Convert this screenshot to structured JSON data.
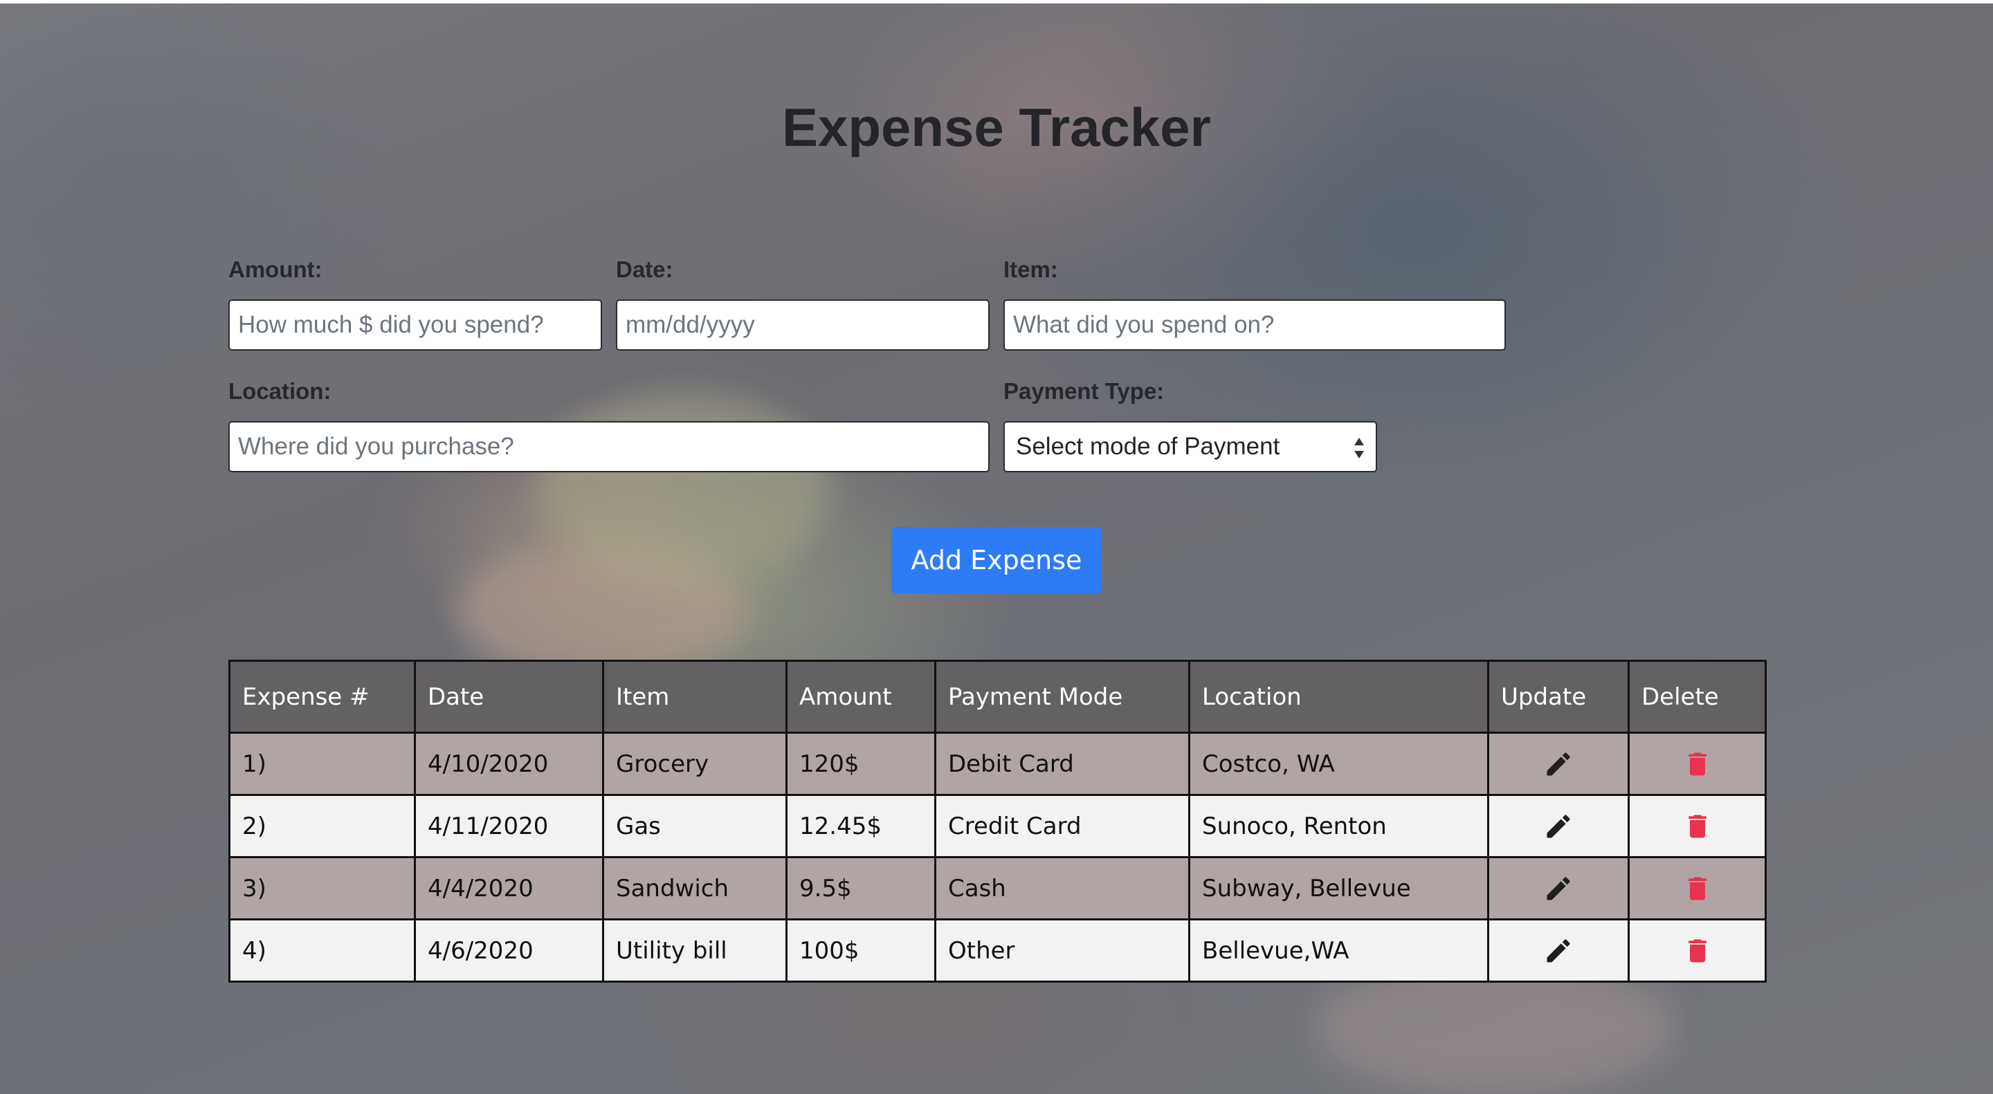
{
  "app": {
    "title": "Expense Tracker"
  },
  "form": {
    "amount": {
      "label": "Amount:",
      "placeholder": "How much $ did you spend?"
    },
    "date": {
      "label": "Date:",
      "placeholder": "mm/dd/yyyy"
    },
    "item": {
      "label": "Item:",
      "placeholder": "What did you spend on?"
    },
    "location": {
      "label": "Location:",
      "placeholder": "Where did you purchase?"
    },
    "payment_type": {
      "label": "Payment Type:",
      "selected": "Select mode of Payment"
    },
    "submit_label": "Add Expense"
  },
  "table": {
    "headers": [
      "Expense #",
      "Date",
      "Item",
      "Amount",
      "Payment Mode",
      "Location",
      "Update",
      "Delete"
    ],
    "rows": [
      {
        "num": "1)",
        "date": "4/10/2020",
        "item": "Grocery",
        "amount": "120$",
        "mode": "Debit Card",
        "location": "Costco, WA"
      },
      {
        "num": "2)",
        "date": "4/11/2020",
        "item": "Gas",
        "amount": "12.45$",
        "mode": "Credit Card",
        "location": "Sunoco, Renton"
      },
      {
        "num": "3)",
        "date": "4/4/2020",
        "item": "Sandwich",
        "amount": "9.5$",
        "mode": "Cash",
        "location": "Subway, Bellevue"
      },
      {
        "num": "4)",
        "date": "4/6/2020",
        "item": "Utility bill",
        "amount": "100$",
        "mode": "Other",
        "location": "Bellevue,WA"
      }
    ],
    "update_icon": "pencil-icon",
    "delete_icon": "trash-icon"
  },
  "colors": {
    "accent": "#2f7bf5",
    "header_bg": "#646164",
    "row_odd": "#b0a5a4",
    "row_even": "#f2f2f2",
    "delete_icon": "#e8324f",
    "edit_icon": "#1f1f1f"
  }
}
